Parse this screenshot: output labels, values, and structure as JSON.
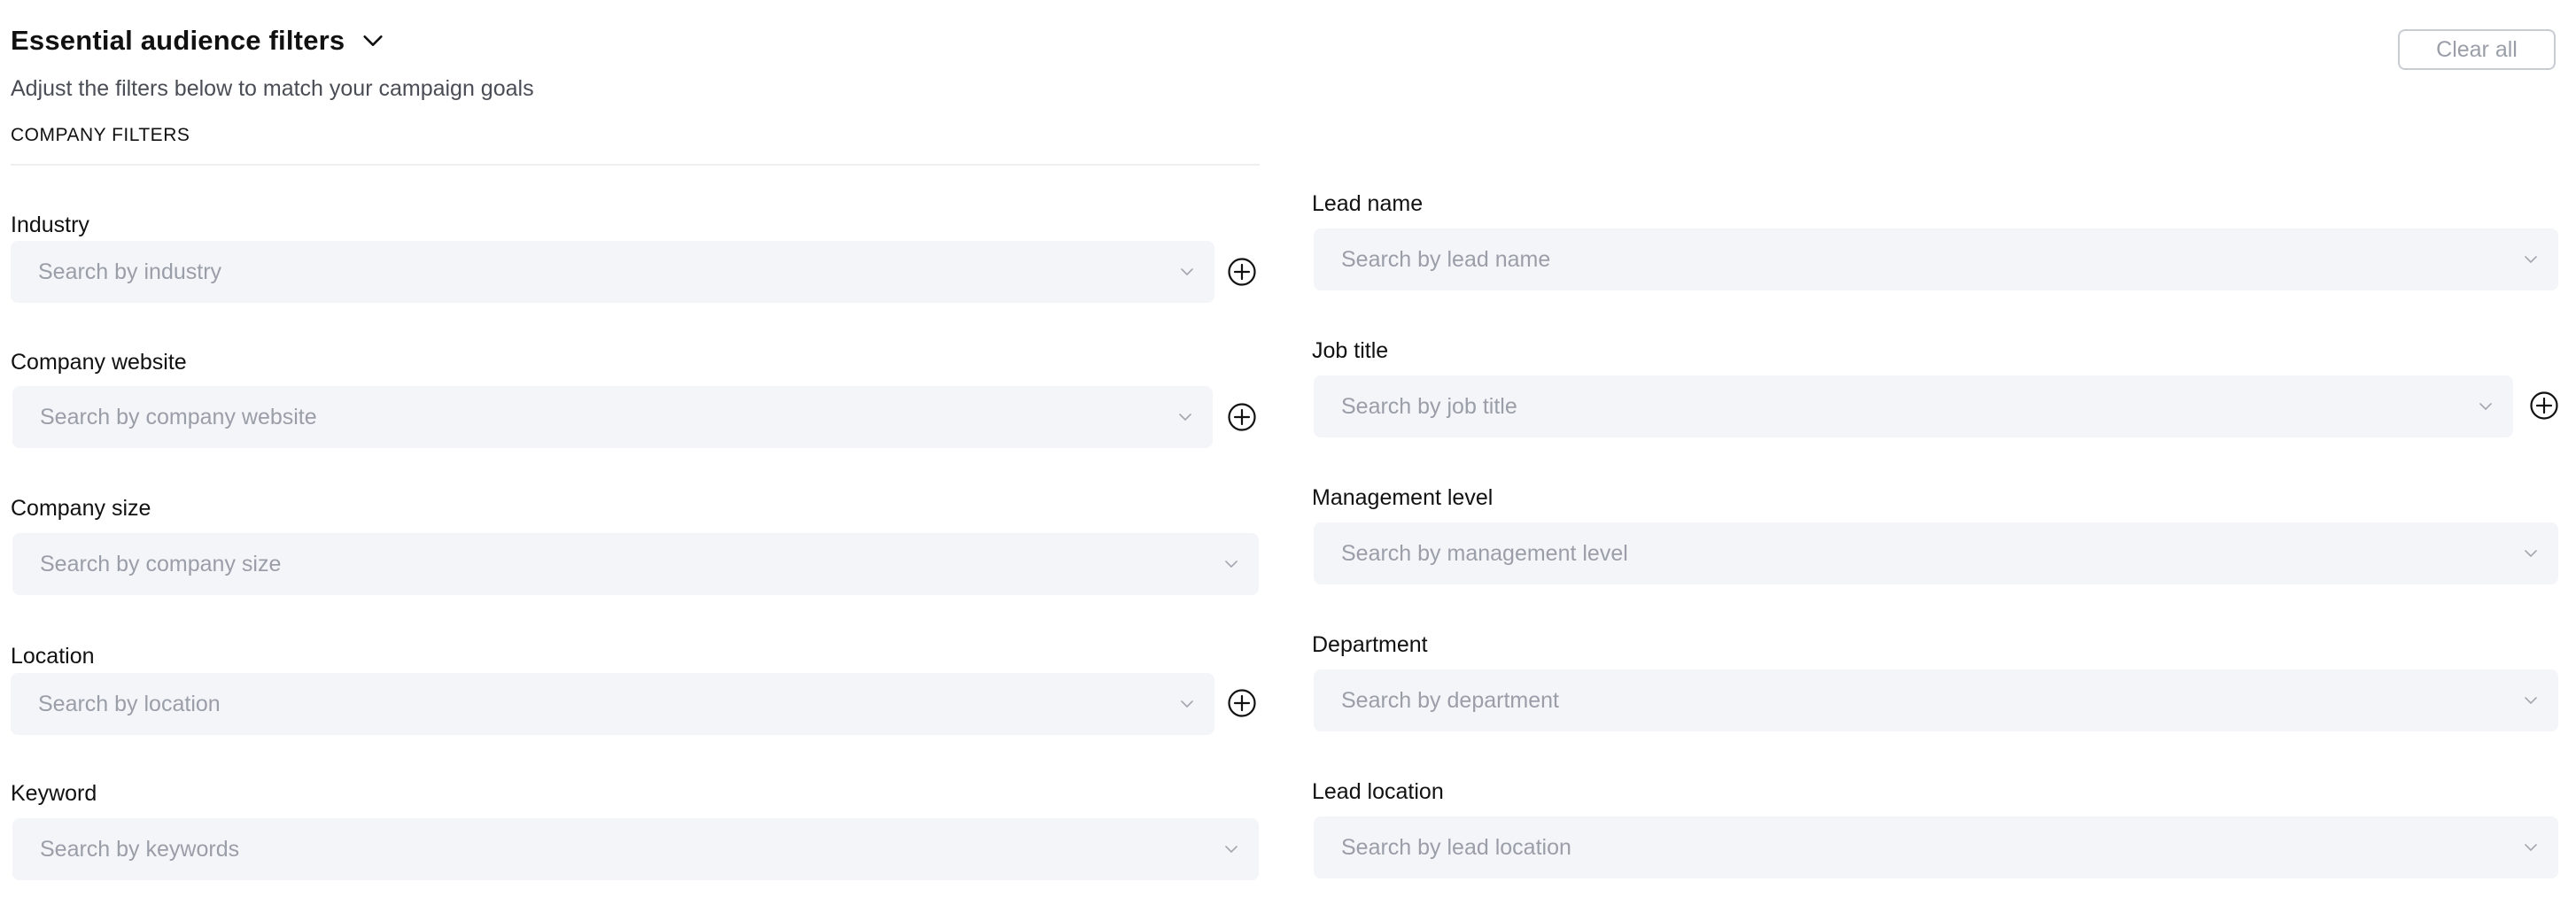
{
  "header": {
    "title": "Essential audience filters",
    "subtitle": "Adjust the filters below to match your campaign goals",
    "section_label": "COMPANY FILTERS",
    "clear_label": "Clear all"
  },
  "icons": {
    "title_toggle": "chevron-down-icon",
    "select_caret": "chevron-down-icon",
    "add": "plus-circle-icon"
  },
  "company_filters": [
    {
      "label": "Industry",
      "placeholder": "Search by industry",
      "has_add": true
    },
    {
      "label": "Company website",
      "placeholder": "Search by company website",
      "has_add": true
    },
    {
      "label": "Company size",
      "placeholder": "Search by company size",
      "has_add": false
    },
    {
      "label": "Location",
      "placeholder": "Search by location",
      "has_add": true
    },
    {
      "label": "Keyword",
      "placeholder": "Search by keywords",
      "has_add": false
    }
  ],
  "lead_filters": [
    {
      "label": "Lead name",
      "placeholder": "Search by lead name",
      "has_add": false
    },
    {
      "label": "Job title",
      "placeholder": "Search by job title",
      "has_add": true
    },
    {
      "label": "Management level",
      "placeholder": "Search by management level",
      "has_add": false
    },
    {
      "label": "Department",
      "placeholder": "Search by department",
      "has_add": false
    },
    {
      "label": "Lead location",
      "placeholder": "Search by lead location",
      "has_add": false
    }
  ],
  "colors": {
    "input_background": "#f4f5f8",
    "placeholder_text": "#9a9ea8",
    "button_border": "#c9ccd3"
  }
}
